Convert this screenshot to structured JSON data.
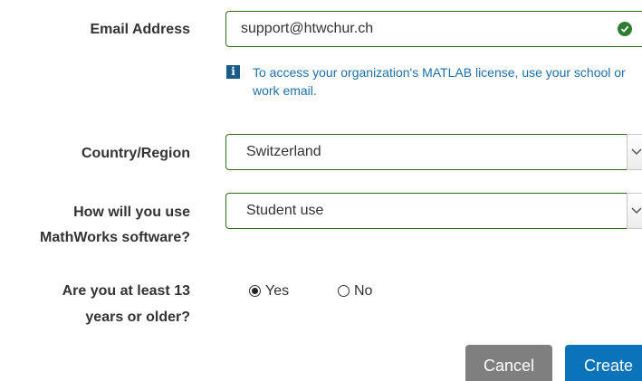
{
  "form": {
    "email": {
      "label": "Email Address",
      "value": "support@htwchur.ch",
      "valid_icon": "check-circle-icon",
      "info_icon": "info-icon",
      "info_text": "To access your organization's MATLAB license, use your school or work email."
    },
    "country": {
      "label": "Country/Region",
      "value": "Switzerland",
      "arrow_icon": "chevron-down-icon"
    },
    "usage": {
      "label_line1": "How will you use",
      "label_line2": "MathWorks software?",
      "value": "Student use",
      "arrow_icon": "chevron-down-icon"
    },
    "age": {
      "label_line1": "Are you at least 13",
      "label_line2": "years or older?",
      "options": [
        {
          "label": "Yes",
          "selected": true
        },
        {
          "label": "No",
          "selected": false
        }
      ]
    }
  },
  "actions": {
    "cancel_label": "Cancel",
    "create_label": "Create"
  },
  "colors": {
    "valid_border": "#2e6b1f",
    "check_green": "#2e7d32",
    "info_blue": "#1e6fa8",
    "cancel_gray": "#7f7f7f",
    "create_blue": "#0a73b9"
  }
}
